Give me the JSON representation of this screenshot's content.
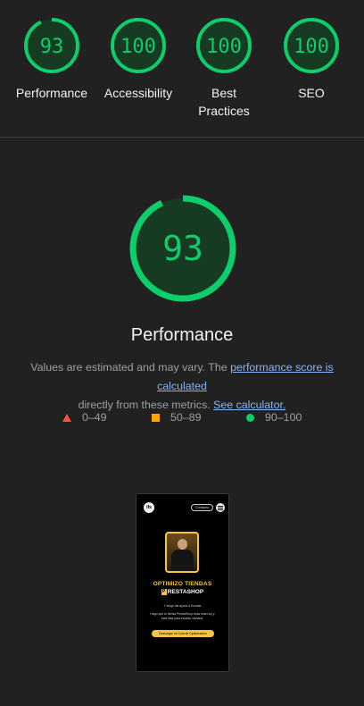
{
  "scores": [
    {
      "label": "Performance",
      "value": "93",
      "score": 93
    },
    {
      "label": "Accessibility",
      "value": "100",
      "score": 100
    },
    {
      "label": "Best Practices",
      "value": "100",
      "score": 100
    },
    {
      "label": "SEO",
      "value": "100",
      "score": 100
    }
  ],
  "main": {
    "score": "93",
    "score_value": 93,
    "title": "Performance",
    "desc_before": "Values are estimated and may vary. The ",
    "desc_link": "performance score is calculated",
    "desc_middle": " directly from these metrics. ",
    "desc_link2": "See calculator."
  },
  "legend": [
    {
      "range": "0–49",
      "shape": "triangle",
      "color": "#ff4e42"
    },
    {
      "range": "50–89",
      "shape": "square",
      "color": "#ffa400"
    },
    {
      "range": "90–100",
      "shape": "circle",
      "color": "#0cce6b"
    }
  ],
  "colors": {
    "pass": "#0cce6b",
    "pass_fill": "#173a22",
    "background": "#212121",
    "link": "#8ab4f8"
  },
  "thumbnail": {
    "logo": "ifs",
    "pill": "Contacto",
    "headline": "OPTIMIZO TIENDAS",
    "brand_mark": "P",
    "brand": "RESTASHOP",
    "line1": "Y luego las ayudo a Escalar",
    "line2": "Hago que tu tienda PrestaShop rinda más hoy y",
    "line3": "esté lista para escalar mañana.",
    "cta": "Descargar mi Guía de Optimización"
  }
}
